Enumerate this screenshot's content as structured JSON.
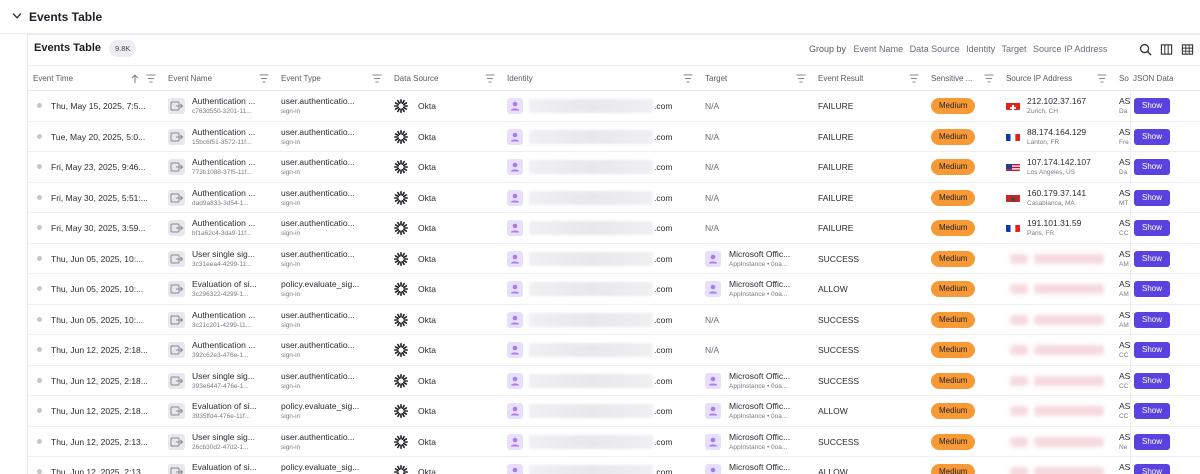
{
  "section": {
    "title": "Events Table"
  },
  "card": {
    "title": "Events Table",
    "count": "9.8K"
  },
  "groupby": {
    "label": "Group by",
    "options": [
      "Event Name",
      "Data Source",
      "Identity",
      "Target",
      "Source IP Address"
    ]
  },
  "toolbar_icons": [
    "search-icon",
    "columns-icon",
    "grid-icon"
  ],
  "columns": {
    "event_time": "Event Time",
    "event_name": "Event Name",
    "event_type": "Event Type",
    "data_source": "Data Source",
    "identity": "Identity",
    "target": "Target",
    "event_result": "Event Result",
    "sensitive": "Sensitive ...",
    "source_ip": "Source IP Address",
    "so": "So",
    "json": "JSON Data"
  },
  "colors": {
    "severity": "#f79a36",
    "show_button": "#5a42e0",
    "identity_icon": "#a77bf3"
  },
  "rows": [
    {
      "time": "Thu, May 15, 2025, 7:5...",
      "name": "Authentication ...",
      "name_sub": "c763d550-3201-11...",
      "type": "user.authenticatio...",
      "type_sub": "sign-in",
      "source": "Okta",
      "identity_suffix": ".com",
      "target": "N/A",
      "target_sub": "",
      "result": "FAILURE",
      "severity": "Medium",
      "ip": "212.102.37.167",
      "ip_loc": "Zurich, CH",
      "flag": "ch",
      "so": "AS",
      "so_sub": "Da",
      "json": "Show"
    },
    {
      "time": "Tue, May 20, 2025, 5:0...",
      "name": "Authentication ...",
      "name_sub": "15bc6f51-3572-11f...",
      "type": "user.authenticatio...",
      "type_sub": "sign-in",
      "source": "Okta",
      "identity_suffix": ".com",
      "target": "N/A",
      "target_sub": "",
      "result": "FAILURE",
      "severity": "Medium",
      "ip": "88.174.164.129",
      "ip_loc": "Lanton, FR",
      "flag": "fr",
      "so": "AS",
      "so_sub": "Fre",
      "json": "Show"
    },
    {
      "time": "Fri, May 23, 2025, 9:46...",
      "name": "Authentication ...",
      "name_sub": "773b1088-37f5-11f...",
      "type": "user.authenticatio...",
      "type_sub": "sign-in",
      "source": "Okta",
      "identity_suffix": ".com",
      "target": "N/A",
      "target_sub": "",
      "result": "FAILURE",
      "severity": "Medium",
      "ip": "107.174.142.107",
      "ip_loc": "Los Angeles, US",
      "flag": "us",
      "so": "AS",
      "so_sub": "Da",
      "json": "Show"
    },
    {
      "time": "Fri, May 30, 2025, 5:51:...",
      "name": "Authentication ...",
      "name_sub": "dad9a833-3d54-1...",
      "type": "user.authenticatio...",
      "type_sub": "sign-in",
      "source": "Okta",
      "identity_suffix": ".com",
      "target": "N/A",
      "target_sub": "",
      "result": "FAILURE",
      "severity": "Medium",
      "ip": "160.179.37.141",
      "ip_loc": "Casablanca, MA",
      "flag": "ma",
      "so": "AS",
      "so_sub": "MT",
      "json": "Show"
    },
    {
      "time": "Fri, May 30, 2025, 3:59...",
      "name": "Authentication ...",
      "name_sub": "bf1a62c4-3da9-11f...",
      "type": "user.authenticatio...",
      "type_sub": "sign-in",
      "source": "Okta",
      "identity_suffix": ".com",
      "target": "N/A",
      "target_sub": "",
      "result": "FAILURE",
      "severity": "Medium",
      "ip": "191.101.31.59",
      "ip_loc": "Paris, FR",
      "flag": "fr",
      "so": "AS",
      "so_sub": "CC",
      "json": "Show"
    },
    {
      "time": "Thu, Jun 05, 2025, 10:...",
      "name": "User single sig...",
      "name_sub": "3c31eea4-4299-11...",
      "type": "user.authenticatio...",
      "type_sub": "sign-in",
      "source": "Okta",
      "identity_suffix": ".com",
      "target": "Microsoft Offic...",
      "target_sub": "AppInstance • 0oa...",
      "result": "SUCCESS",
      "severity": "Medium",
      "ip": "",
      "ip_loc": "",
      "flag": "",
      "so": "AS",
      "so_sub": "AM",
      "json": "Show"
    },
    {
      "time": "Thu, Jun 05, 2025, 10:...",
      "name": "Evaluation of si...",
      "name_sub": "3c296322-4299-1...",
      "type": "policy.evaluate_sig...",
      "type_sub": "sign-in",
      "source": "Okta",
      "identity_suffix": ".com",
      "target": "Microsoft Offic...",
      "target_sub": "AppInstance • 0oa...",
      "result": "ALLOW",
      "severity": "Medium",
      "ip": "",
      "ip_loc": "",
      "flag": "",
      "so": "AS",
      "so_sub": "AM",
      "json": "Show"
    },
    {
      "time": "Thu, Jun 05, 2025, 10:...",
      "name": "Authentication ...",
      "name_sub": "3c21c201-4299-11...",
      "type": "user.authenticatio...",
      "type_sub": "sign-in",
      "source": "Okta",
      "identity_suffix": ".com",
      "target": "N/A",
      "target_sub": "",
      "result": "SUCCESS",
      "severity": "Medium",
      "ip": "",
      "ip_loc": "",
      "flag": "",
      "so": "AS",
      "so_sub": "AM",
      "json": "Show"
    },
    {
      "time": "Thu, Jun 12, 2025, 2:18...",
      "name": "Authentication ...",
      "name_sub": "392c62e3-476e-1...",
      "type": "user.authenticatio...",
      "type_sub": "sign-in",
      "source": "Okta",
      "identity_suffix": ".com",
      "target": "N/A",
      "target_sub": "",
      "result": "SUCCESS",
      "severity": "Medium",
      "ip": "",
      "ip_loc": "",
      "flag": "",
      "so": "AS",
      "so_sub": "CC",
      "json": "Show"
    },
    {
      "time": "Thu, Jun 12, 2025, 2:18...",
      "name": "User single sig...",
      "name_sub": "393e6447-476e-1...",
      "type": "user.authenticatio...",
      "type_sub": "sign-in",
      "source": "Okta",
      "identity_suffix": ".com",
      "target": "Microsoft Offic...",
      "target_sub": "AppInstance • 0oa...",
      "result": "SUCCESS",
      "severity": "Medium",
      "ip": "",
      "ip_loc": "",
      "flag": "",
      "so": "AS",
      "so_sub": "CC",
      "json": "Show"
    },
    {
      "time": "Thu, Jun 12, 2025, 2:18...",
      "name": "Evaluation of si...",
      "name_sub": "3935ffd4-476e-11f...",
      "type": "policy.evaluate_sig...",
      "type_sub": "sign-in",
      "source": "Okta",
      "identity_suffix": ".com",
      "target": "Microsoft Offic...",
      "target_sub": "AppInstance • 0oa...",
      "result": "ALLOW",
      "severity": "Medium",
      "ip": "",
      "ip_loc": "",
      "flag": "",
      "so": "AS",
      "so_sub": "CC",
      "json": "Show"
    },
    {
      "time": "Thu, Jun 12, 2025, 2:13...",
      "name": "User single sig...",
      "name_sub": "26cb30d2-47d2-1...",
      "type": "user.authenticatio...",
      "type_sub": "sign-in",
      "source": "Okta",
      "identity_suffix": ".com",
      "target": "Microsoft Offic...",
      "target_sub": "AppInstance • 0oa...",
      "result": "SUCCESS",
      "severity": "Medium",
      "ip": "",
      "ip_loc": "",
      "flag": "",
      "so": "AS",
      "so_sub": "Ne",
      "json": "Show"
    },
    {
      "time": "Thu, Jun 12, 2025, 2:13...",
      "name": "Evaluation of si...",
      "name_sub": "",
      "type": "policy.evaluate_sig...",
      "type_sub": "",
      "source": "Okta",
      "identity_suffix": ".com",
      "target": "Microsoft Offic...",
      "target_sub": "",
      "result": "ALLOW",
      "severity": "Medium",
      "ip": "",
      "ip_loc": "",
      "flag": "",
      "so": "AS",
      "so_sub": "",
      "json": "Show"
    }
  ]
}
